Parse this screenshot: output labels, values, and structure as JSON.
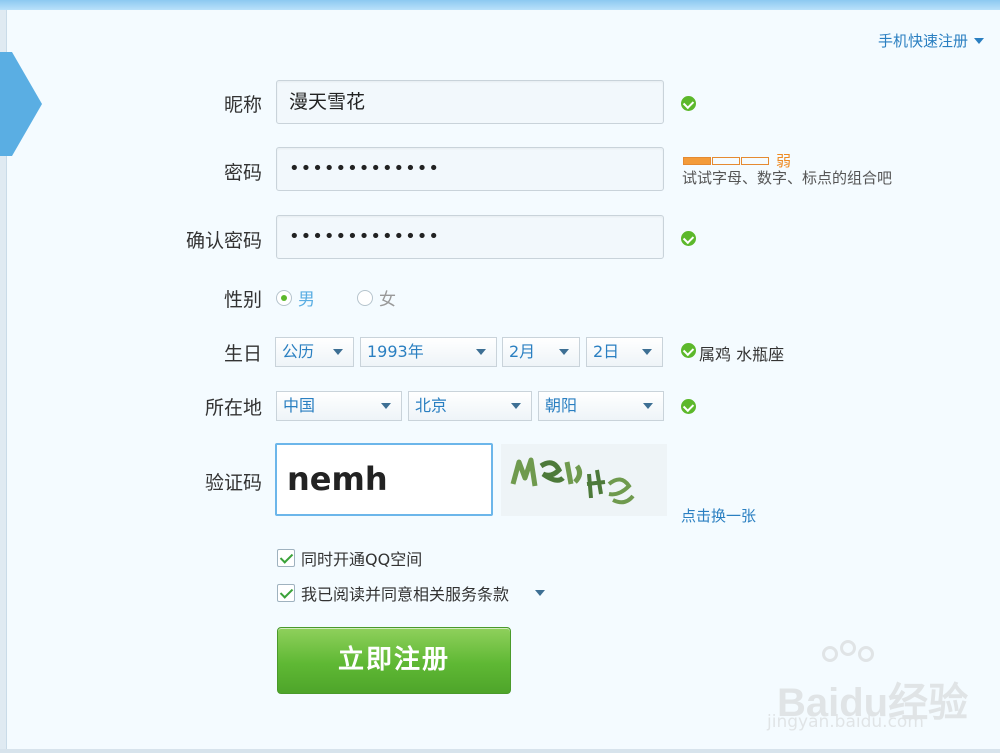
{
  "header": {
    "mobile_register": "手机快速注册"
  },
  "form": {
    "nickname": {
      "label": "昵称",
      "value": "漫天雪花"
    },
    "password": {
      "label": "密码",
      "value": "•••••••••••••",
      "strength": "弱",
      "hint": "试试字母、数字、标点的组合吧"
    },
    "confirm_password": {
      "label": "确认密码",
      "value": "•••••••••••••"
    },
    "gender": {
      "label": "性别",
      "male": "男",
      "female": "女",
      "selected": "男"
    },
    "birthday": {
      "label": "生日",
      "calendar": "公历",
      "year": "1993年",
      "month": "2月",
      "day": "2日",
      "zodiac": "属鸡  水瓶座"
    },
    "location": {
      "label": "所在地",
      "country": "中国",
      "province": "北京",
      "city": "朝阳"
    },
    "captcha": {
      "label": "验证码",
      "value": "nemh",
      "refresh": "点击换一张"
    },
    "options": {
      "qzone": "同时开通QQ空间",
      "agree": "我已阅读并同意相关服务条款"
    },
    "submit": "立即注册"
  },
  "watermark": {
    "brand": "Baidu经验",
    "url": "jingyan.baidu.com"
  },
  "colors": {
    "accent": "#2a7fc1",
    "success": "#5cb82b",
    "warning": "#f39b3a"
  }
}
